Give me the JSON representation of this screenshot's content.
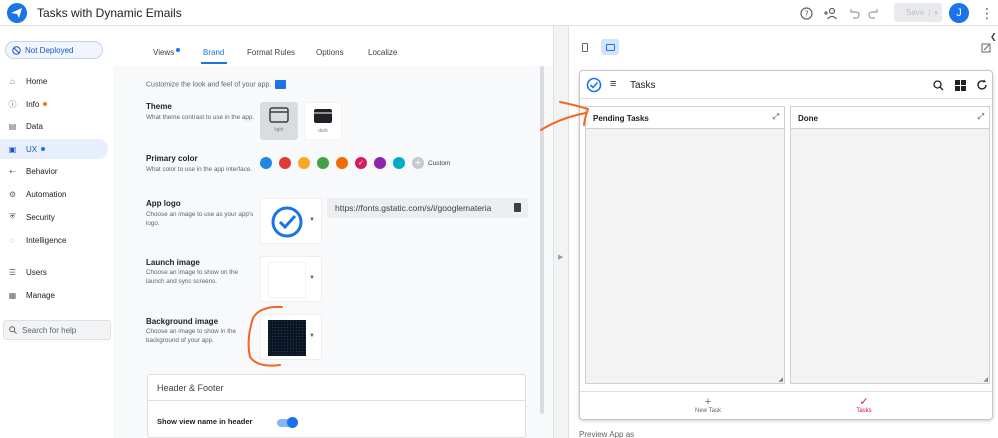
{
  "app": {
    "title": "Tasks with Dynamic Emails",
    "save_label": "Save",
    "avatar_initial": "J"
  },
  "sidebar": {
    "deploy_status": "Not Deployed",
    "items": [
      {
        "label": "Home",
        "icon": "home-icon"
      },
      {
        "label": "Info",
        "icon": "info-icon",
        "badge_color": "#f57c00"
      },
      {
        "label": "Data",
        "icon": "data-icon"
      },
      {
        "label": "UX",
        "icon": "ux-icon",
        "badge_color": "#1a73e8",
        "active": true
      },
      {
        "label": "Behavior",
        "icon": "behavior-icon"
      },
      {
        "label": "Automation",
        "icon": "automation-icon"
      },
      {
        "label": "Security",
        "icon": "security-icon"
      },
      {
        "label": "Intelligence",
        "icon": "intelligence-icon"
      },
      {
        "label": "Users",
        "icon": "users-icon"
      },
      {
        "label": "Manage",
        "icon": "manage-icon"
      }
    ],
    "search_placeholder": "Search for help"
  },
  "tabs": [
    {
      "label": "Views",
      "has_dot": true
    },
    {
      "label": "Brand",
      "active": true
    },
    {
      "label": "Format Rules"
    },
    {
      "label": "Options"
    },
    {
      "label": "Localize"
    }
  ],
  "brand": {
    "intro": "Customize the look and feel of your app.",
    "theme": {
      "title": "Theme",
      "desc": "What theme contrast to use in the app.",
      "options": [
        {
          "label": "light",
          "selected": true
        },
        {
          "label": "dark"
        }
      ]
    },
    "primary_color": {
      "title": "Primary color",
      "desc": "What color to use in the app interface.",
      "colors": [
        "#1e88e5",
        "#e53935",
        "#f9a825",
        "#43a047",
        "#ef6c00",
        "#d81b60",
        "#8e24aa",
        "#00acc1"
      ],
      "selected_index": 5,
      "custom_label": "Custom"
    },
    "app_logo": {
      "title": "App logo",
      "desc": "Choose an image to use as your app's logo.",
      "url": "https://fonts.gstatic.com/s/i/googlemateria"
    },
    "launch_image": {
      "title": "Launch image",
      "desc": "Choose an image to show on the launch and sync screens."
    },
    "background_image": {
      "title": "Background image",
      "desc": "Choose an image to show in the background of your app."
    },
    "header_footer": {
      "title": "Header & Footer",
      "show_view_name": "Show view name in header"
    }
  },
  "preview": {
    "app_title": "Tasks",
    "columns": [
      {
        "title": "Pending Tasks"
      },
      {
        "title": "Done"
      }
    ],
    "nav": [
      {
        "label": "New Task"
      },
      {
        "label": "Tasks",
        "active": true
      }
    ],
    "preview_as": "Preview App as"
  }
}
